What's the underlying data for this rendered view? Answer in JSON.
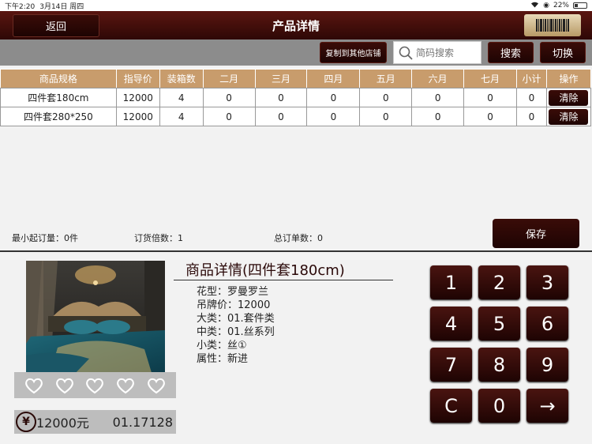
{
  "status": {
    "time": "下午2:20",
    "date": "3月14日 周四",
    "battery": "22%"
  },
  "header": {
    "back_label": "返回",
    "title": "产品详情"
  },
  "toolbar": {
    "copy_label": "复制到其他店铺",
    "search_placeholder": "简码搜索",
    "search_label": "搜索",
    "switch_label": "切换"
  },
  "table": {
    "headers": [
      "商品规格",
      "指导价",
      "装箱数",
      "二月",
      "三月",
      "四月",
      "五月",
      "六月",
      "七月",
      "小计",
      "操作"
    ],
    "rows": [
      {
        "spec": "四件套180cm",
        "price": "12000",
        "box": "4",
        "m2": "0",
        "m3": "0",
        "m4": "0",
        "m5": "0",
        "m6": "0",
        "m7": "0",
        "subtotal": "0",
        "action": "清除"
      },
      {
        "spec": "四件套280*250",
        "price": "12000",
        "box": "4",
        "m2": "0",
        "m3": "0",
        "m4": "0",
        "m5": "0",
        "m6": "0",
        "m7": "0",
        "subtotal": "0",
        "action": "清除"
      }
    ]
  },
  "summary": {
    "min_order": "最小起订量：0件",
    "multiple": "订货倍数：1",
    "total": "总订单数：0",
    "save_label": "保存"
  },
  "product": {
    "title": "商品详情(四件套180cm)",
    "attrs": [
      {
        "label": "花型：",
        "value": "罗曼罗兰"
      },
      {
        "label": "吊牌价：",
        "value": "12000"
      },
      {
        "label": "大类：",
        "value": "01.套件类"
      },
      {
        "label": "中类：",
        "value": "01.丝系列"
      },
      {
        "label": "小类：",
        "value": "丝①"
      },
      {
        "label": "属性：",
        "value": "新进"
      }
    ],
    "price": "12000元",
    "code": "01.17128",
    "currency_symbol": "¥"
  },
  "keypad": [
    "1",
    "2",
    "3",
    "4",
    "5",
    "6",
    "7",
    "8",
    "9",
    "C",
    "0",
    "→"
  ]
}
